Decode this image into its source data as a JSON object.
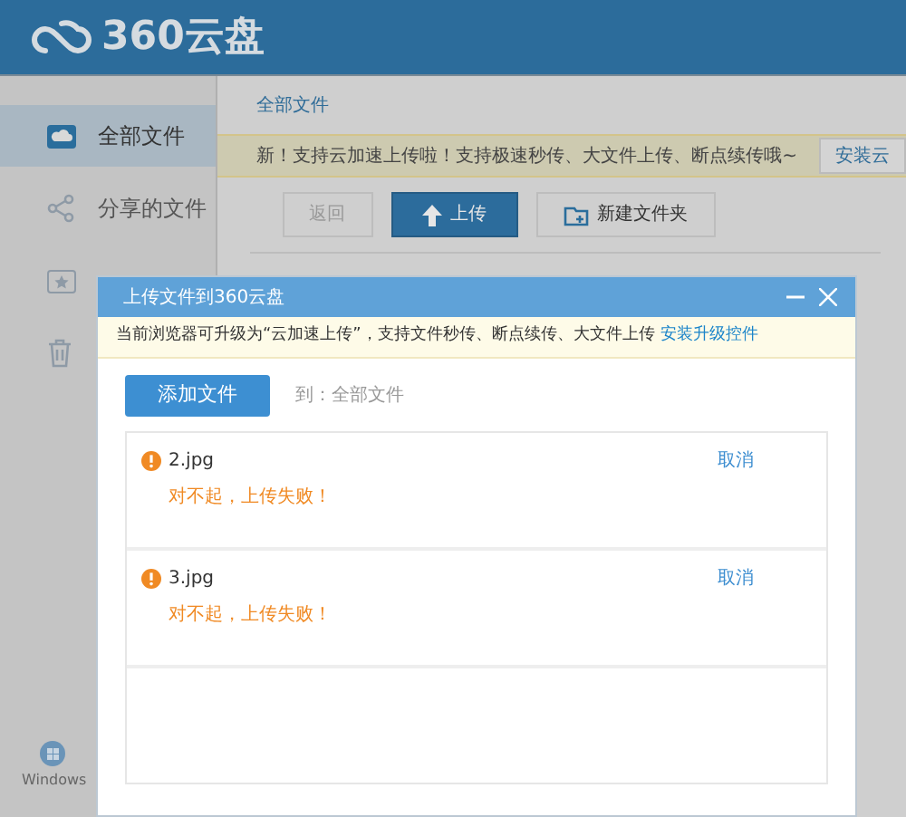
{
  "header": {
    "logo_text": "360云盘"
  },
  "sidebar": {
    "items": [
      {
        "label": "全部文件",
        "selected": true,
        "kind": "cloud"
      },
      {
        "label": "分享的文件",
        "selected": false,
        "kind": "share"
      },
      {
        "selected": false,
        "kind": "star"
      },
      {
        "selected": false,
        "kind": "trash"
      }
    ],
    "footer_label": "Windows"
  },
  "main": {
    "breadcrumb": "全部文件",
    "notice": "新！支持云加速上传啦！支持极速秒传、大文件上传、断点续传哦~",
    "notice_button": "安装云",
    "toolbar": [
      {
        "label": "返回",
        "kind": "back"
      },
      {
        "label": "上传",
        "kind": "upload"
      },
      {
        "label": "新建文件夹",
        "kind": "folder"
      }
    ]
  },
  "dialog": {
    "title": "上传文件到360云盘",
    "notice": "当前浏览器可升级为“云加速上传”，支持文件秒传、断点续传、大文件上传",
    "notice_link": "安装升级控件",
    "add_button": "添加文件",
    "destination": "到：全部文件",
    "files": [
      {
        "name": "2.jpg",
        "status": "对不起，上传失败！",
        "action": "取消"
      },
      {
        "name": "3.jpg",
        "status": "对不起，上传失败！",
        "action": "取消"
      }
    ]
  }
}
